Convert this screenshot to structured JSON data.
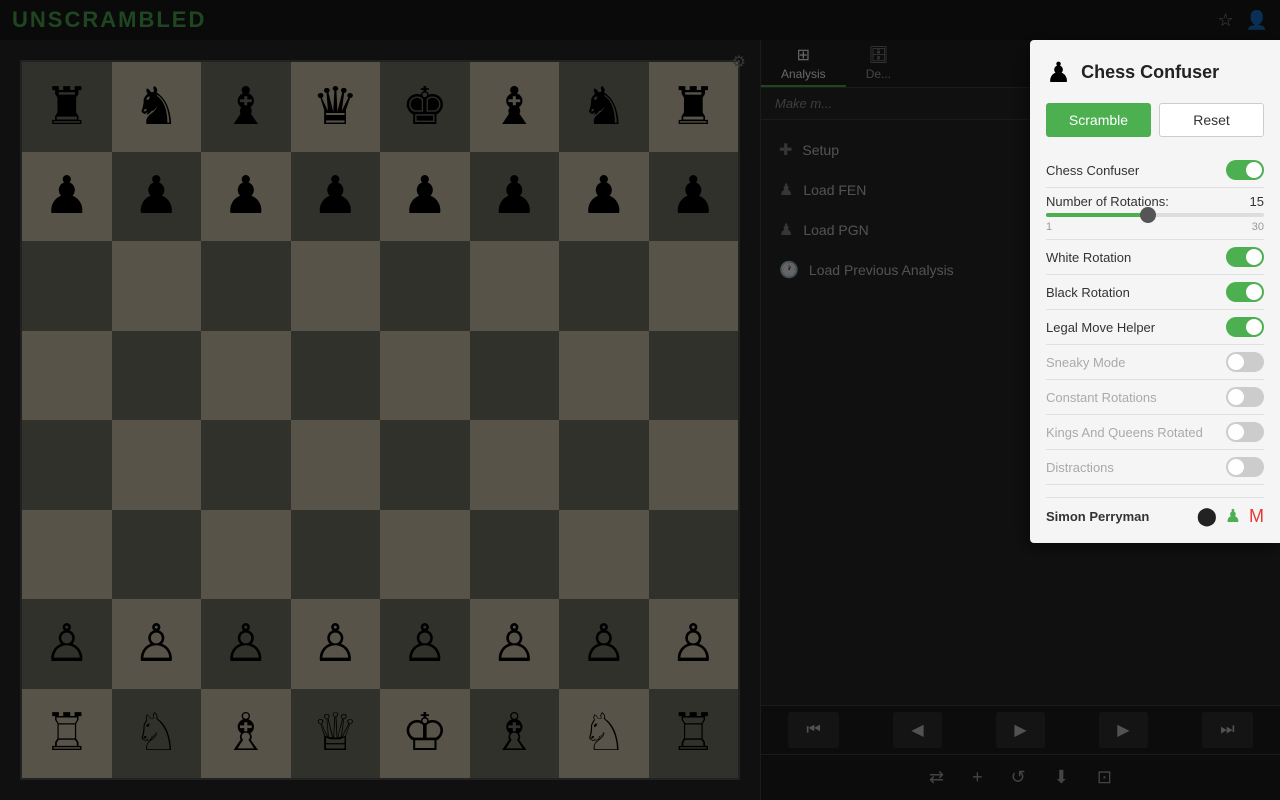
{
  "topbar": {
    "title": "UNSCRAMBLED",
    "icons": [
      "star",
      "user"
    ]
  },
  "tabs": [
    {
      "id": "analysis",
      "label": "Analysis",
      "icon": "⊞",
      "active": true
    },
    {
      "id": "database",
      "label": "De...",
      "icon": "🗄",
      "active": false
    }
  ],
  "make_move_hint": "Make m...",
  "menu": {
    "items": [
      {
        "id": "setup",
        "icon": "+",
        "label": "Setup"
      },
      {
        "id": "load-fen",
        "icon": "♟",
        "label": "Load FEN"
      },
      {
        "id": "load-pgn",
        "icon": "♟",
        "label": "Load PGN"
      },
      {
        "id": "load-previous",
        "icon": "🕐",
        "label": "Load Previous Analysis"
      }
    ]
  },
  "nav_buttons": [
    {
      "id": "first",
      "icon": "⏮"
    },
    {
      "id": "prev",
      "icon": "◀"
    },
    {
      "id": "play",
      "icon": "▶"
    },
    {
      "id": "next",
      "icon": "▶"
    },
    {
      "id": "last",
      "icon": "⏭"
    }
  ],
  "action_buttons": [
    "⇄",
    "+",
    "↺",
    "⬇",
    "⊡"
  ],
  "board": {
    "rows": [
      [
        "♜",
        "♞",
        "♝",
        "♛",
        "♚",
        "♝",
        "♞",
        "♜"
      ],
      [
        "♟",
        "♟",
        "♟",
        "♟",
        "♟",
        "♟",
        "♟",
        "♟"
      ],
      [
        "",
        "",
        "",
        "",
        "",
        "",
        "",
        ""
      ],
      [
        "",
        "",
        "",
        "",
        "",
        "",
        "",
        ""
      ],
      [
        "",
        "",
        "",
        "",
        "",
        "",
        "",
        ""
      ],
      [
        "",
        "",
        "",
        "",
        "",
        "",
        "",
        ""
      ],
      [
        "♙",
        "♙",
        "♙",
        "♙",
        "♙",
        "♙",
        "♙",
        "♙"
      ],
      [
        "♖",
        "♘",
        "♗",
        "♕",
        "♔",
        "♗",
        "♘",
        "♖"
      ]
    ]
  },
  "popup": {
    "logo": "♟",
    "title": "Chess Confuser",
    "buttons": {
      "scramble": "Scramble",
      "reset": "Reset"
    },
    "toggles": [
      {
        "id": "chess-confuser",
        "label": "Chess Confuser",
        "state": "on",
        "disabled": false
      },
      {
        "id": "white-rotation",
        "label": "White Rotation",
        "state": "on",
        "disabled": false
      },
      {
        "id": "black-rotation",
        "label": "Black Rotation",
        "state": "on",
        "disabled": false
      },
      {
        "id": "legal-move-helper",
        "label": "Legal Move Helper",
        "state": "on",
        "disabled": false
      },
      {
        "id": "sneaky-mode",
        "label": "Sneaky Mode",
        "state": "off",
        "disabled": true
      },
      {
        "id": "constant-rotations",
        "label": "Constant Rotations",
        "state": "off",
        "disabled": true
      },
      {
        "id": "kings-queens-rotated",
        "label": "Kings And Queens Rotated",
        "state": "off",
        "disabled": true
      },
      {
        "id": "distractions",
        "label": "Distractions",
        "state": "off",
        "disabled": true
      }
    ],
    "slider": {
      "label": "Number of Rotations:",
      "value": 15,
      "min": 1,
      "max": 30,
      "percent": 47
    },
    "footer": {
      "user": "Simon Perryman",
      "icons": [
        "github",
        "chess",
        "gmail"
      ]
    }
  },
  "settings_icon": "⚙"
}
